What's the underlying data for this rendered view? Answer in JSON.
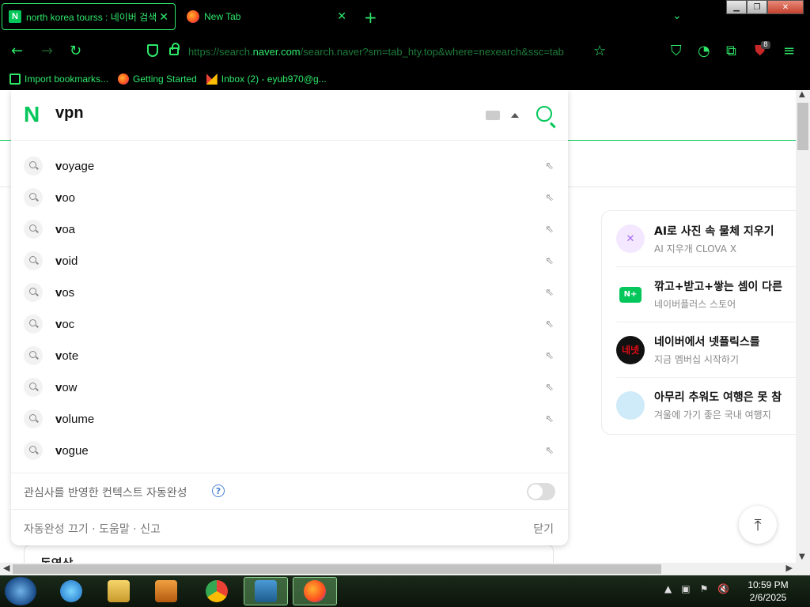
{
  "browser": {
    "tabs": [
      {
        "title": "north korea tourss : 네이버 검색",
        "active": true
      },
      {
        "title": "New Tab",
        "active": false
      }
    ],
    "url_prefix": "https://search.",
    "url_host": "naver.com",
    "url_rest": "/search.naver?sm=tab_hty.top&where=nexearch&ssc=tab",
    "extension_badge": "8",
    "bookmarks": [
      {
        "label": "Import bookmarks..."
      },
      {
        "label": "Getting Started"
      },
      {
        "label": "Inbox (2) - eyub970@g..."
      }
    ]
  },
  "search": {
    "query": "vpn",
    "suggestions": [
      {
        "prefix": "v",
        "rest": "oyage"
      },
      {
        "prefix": "v",
        "rest": "oo"
      },
      {
        "prefix": "v",
        "rest": "oa"
      },
      {
        "prefix": "v",
        "rest": "oid"
      },
      {
        "prefix": "v",
        "rest": "os"
      },
      {
        "prefix": "v",
        "rest": "oc"
      },
      {
        "prefix": "v",
        "rest": "ote"
      },
      {
        "prefix": "v",
        "rest": "ow"
      },
      {
        "prefix": "v",
        "rest": "olume"
      },
      {
        "prefix": "v",
        "rest": "ogue"
      }
    ],
    "context_label": "관심사를 반영한 컨텍스트 자동완성",
    "help_glyph": "?",
    "footer_left": "자동완성 끄기 · 도움말 · 신고",
    "footer_close": "닫기"
  },
  "page": {
    "video_section_title": "동영상",
    "right_panel": [
      {
        "title": "AI로 사진 속 물체 지우기",
        "subtitle": "AI 지우개 CLOVA X",
        "icon": "clova-icon",
        "color": "#a86cf0"
      },
      {
        "title": "깎고+받고+쌓는 셈이 다른",
        "subtitle": "네이버플러스 스토어",
        "icon": "naver-plus-icon",
        "color": "#03c75a"
      },
      {
        "title": "네이버에서 넷플릭스를",
        "subtitle": "지금 멤버십 시작하기",
        "icon": "netflix-icon",
        "color": "#111111"
      },
      {
        "title": "아무리 추워도 여행은 못 참",
        "subtitle": "겨울에 가기 좋은 국내 여행지",
        "icon": "travel-icon",
        "color": "#9cd4f0"
      }
    ],
    "right_panel_icon_text": [
      "",
      "N+",
      "네넷",
      ""
    ]
  },
  "taskbar": {
    "time": "10:59 PM",
    "date": "2/6/2025"
  },
  "colors": {
    "brand": "#03c75a",
    "browser_accent": "#2ee86a"
  }
}
